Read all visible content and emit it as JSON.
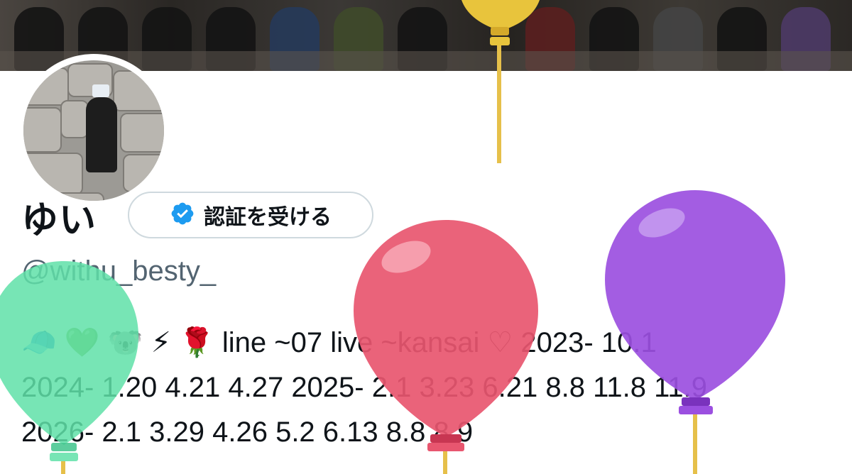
{
  "profile": {
    "display_name": "ゆい",
    "verify_button_label": "認証を受ける",
    "handle": "@withu_besty_",
    "bio_lines": [
      "🧢 💚 🐨 ⚡ 🌹 line ~07 live ~kansai ♡ 2023- 10.1",
      "2024- 1.20 4.21 4.27 2025- 2.1 3.23 6.21 8.8 11.8 11.9",
      "2026- 2.1 3.29 4.26 5.2 6.13 8.8 8.9"
    ]
  },
  "icons": {
    "verified": "verified-badge-icon",
    "balloons": [
      "green-balloon",
      "pink-balloon",
      "purple-balloon",
      "yellow-balloon"
    ]
  },
  "colors": {
    "verified_blue": "#1d9bf0",
    "balloon_green": "#5fe0a8",
    "balloon_pink": "#e8566f",
    "balloon_purple": "#9b4fe0",
    "balloon_yellow": "#e8c43c",
    "handle_gray": "#536471"
  }
}
